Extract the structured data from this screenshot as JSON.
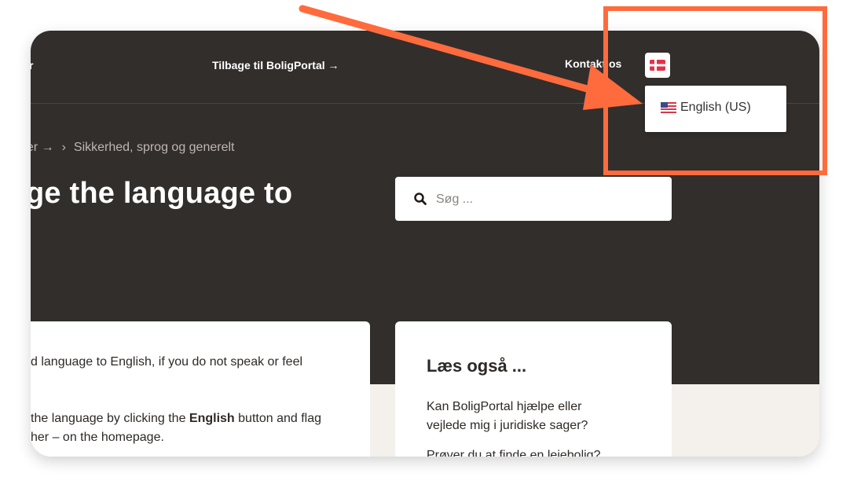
{
  "nav": {
    "left_partial": "r",
    "back_link": "Tilbage til BoligPortal →",
    "contact": "Kontakt os",
    "lang_flag": "danish-flag-icon"
  },
  "language_dropdown": {
    "item_label": "English (US)",
    "item_flag": "us-flag-icon"
  },
  "breadcrumb": {
    "first": "ger →",
    "separator": "›",
    "current": "Sikkerhed, sprog og generelt"
  },
  "page_title": "ge the language to",
  "search": {
    "placeholder": "Søg ..."
  },
  "article_card": {
    "line1": "d language to English, if you do not speak or feel",
    "line2_before": "the language by clicking the ",
    "line2_bold": "English",
    "line2_after": " button and flag",
    "line3": "her – on the homepage."
  },
  "related_card": {
    "heading": "Læs også ...",
    "link1_line1": "Kan BoligPortal hjælpe eller",
    "link1_line2": "vejlede mig i juridiske sager?",
    "link2_line1": "Prøver du at finde en lejebolig?"
  },
  "annotation": {
    "color": "#ff6b3d"
  }
}
